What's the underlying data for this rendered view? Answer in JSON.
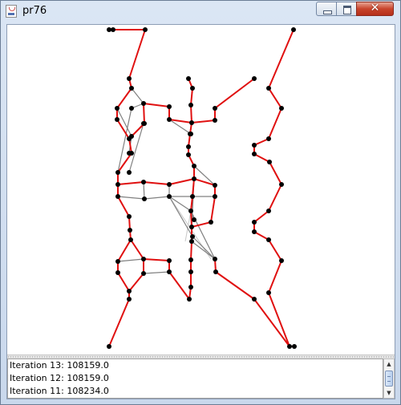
{
  "window": {
    "title": "pr76",
    "close_glyph": "✕",
    "icons": [
      "java-icon",
      "minimize-icon",
      "maximize-icon",
      "close-icon"
    ]
  },
  "tour_plot": {
    "colors": {
      "tour_edge": "#e01010",
      "candidate_edge": "#808080",
      "node": "#000000"
    }
  },
  "log": {
    "lines": [
      "Iteration 13: 108159.0",
      "Iteration 12: 108159.0",
      "Iteration 11: 108234.0"
    ]
  },
  "scrollbar": {
    "up_glyph": "▲",
    "down_glyph": "▼"
  }
}
